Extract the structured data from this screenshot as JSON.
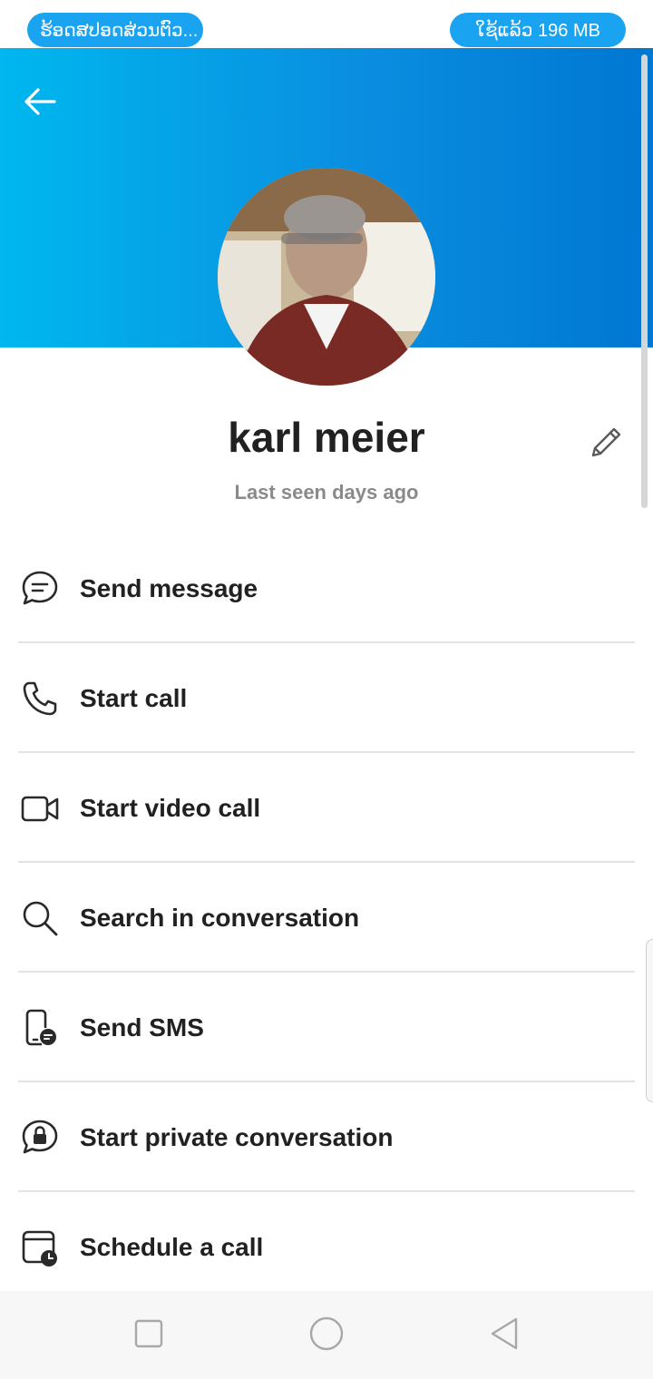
{
  "status_bar": {
    "left_pill": "ຮ້ອດສປອດສ່ວນຕົວ...",
    "right_pill": "ໃຊ້ແລ້ວ 196 MB"
  },
  "header": {
    "gradient_start": "#00b7ee",
    "gradient_end": "#0077d2",
    "back_icon": "arrow-left-icon"
  },
  "profile": {
    "name": "karl meier",
    "status": "Last seen days ago",
    "edit_icon": "pencil-icon"
  },
  "actions": [
    {
      "label": "Send message",
      "icon": "chat-bubble-icon"
    },
    {
      "label": "Start call",
      "icon": "phone-icon"
    },
    {
      "label": "Start video call",
      "icon": "video-camera-icon"
    },
    {
      "label": "Search in conversation",
      "icon": "search-icon"
    },
    {
      "label": "Send SMS",
      "icon": "phone-sms-icon"
    },
    {
      "label": "Start private conversation",
      "icon": "lock-bubble-icon"
    },
    {
      "label": "Schedule a call",
      "icon": "calendar-clock-icon"
    }
  ],
  "navbar": {
    "recents_icon": "square-icon",
    "home_icon": "circle-icon",
    "back_icon": "triangle-back-icon"
  }
}
